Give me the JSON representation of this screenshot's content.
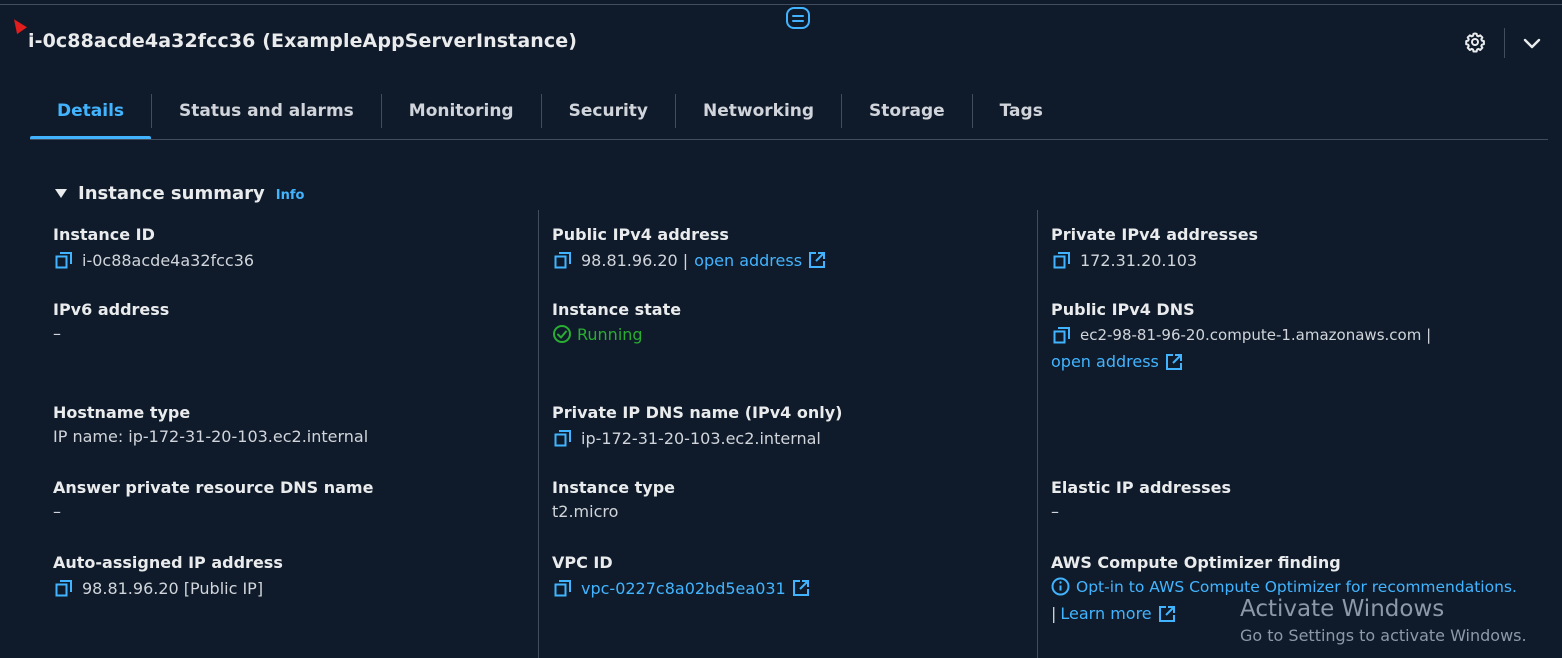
{
  "header": {
    "title": "i-0c88acde4a32fcc36 (ExampleAppServerInstance)"
  },
  "tabs": [
    {
      "label": "Details",
      "active": true
    },
    {
      "label": "Status and alarms"
    },
    {
      "label": "Monitoring"
    },
    {
      "label": "Security"
    },
    {
      "label": "Networking"
    },
    {
      "label": "Storage"
    },
    {
      "label": "Tags"
    }
  ],
  "section": {
    "title": "Instance summary",
    "info_label": "Info"
  },
  "fields": {
    "instance_id": {
      "label": "Instance ID",
      "value": "i-0c88acde4a32fcc36"
    },
    "ipv6": {
      "label": "IPv6 address",
      "value": "–"
    },
    "hostname_type": {
      "label": "Hostname type",
      "value": "IP name: ip-172-31-20-103.ec2.internal"
    },
    "answer_dns": {
      "label": "Answer private resource DNS name",
      "value": "–"
    },
    "auto_ip": {
      "label": "Auto-assigned IP address",
      "value": "98.81.96.20 [Public IP]"
    },
    "public_ipv4": {
      "label": "Public IPv4 address",
      "value": "98.81.96.20 |",
      "link": "open address"
    },
    "instance_state": {
      "label": "Instance state",
      "value": "Running"
    },
    "private_dns": {
      "label": "Private IP DNS name (IPv4 only)",
      "value": "ip-172-31-20-103.ec2.internal"
    },
    "instance_type": {
      "label": "Instance type",
      "value": "t2.micro"
    },
    "vpc_id": {
      "label": "VPC ID",
      "value": "vpc-0227c8a02bd5ea031"
    },
    "private_ipv4": {
      "label": "Private IPv4 addresses",
      "value": "172.31.20.103"
    },
    "public_dns": {
      "label": "Public IPv4 DNS",
      "value": "ec2-98-81-96-20.compute-1.amazonaws.com |",
      "link": "open address"
    },
    "elastic_ip": {
      "label": "Elastic IP addresses",
      "value": "–"
    },
    "optimizer": {
      "label": "AWS Compute Optimizer finding",
      "link": "Opt-in to AWS Compute Optimizer for recommendations.",
      "sep": "|",
      "learn": "Learn more"
    }
  },
  "watermark": {
    "line1": "Activate Windows",
    "line2": "Go to Settings to activate Windows."
  },
  "colors": {
    "background": "#0f1b2a",
    "accent": "#42b4ff",
    "success": "#29ad32"
  }
}
